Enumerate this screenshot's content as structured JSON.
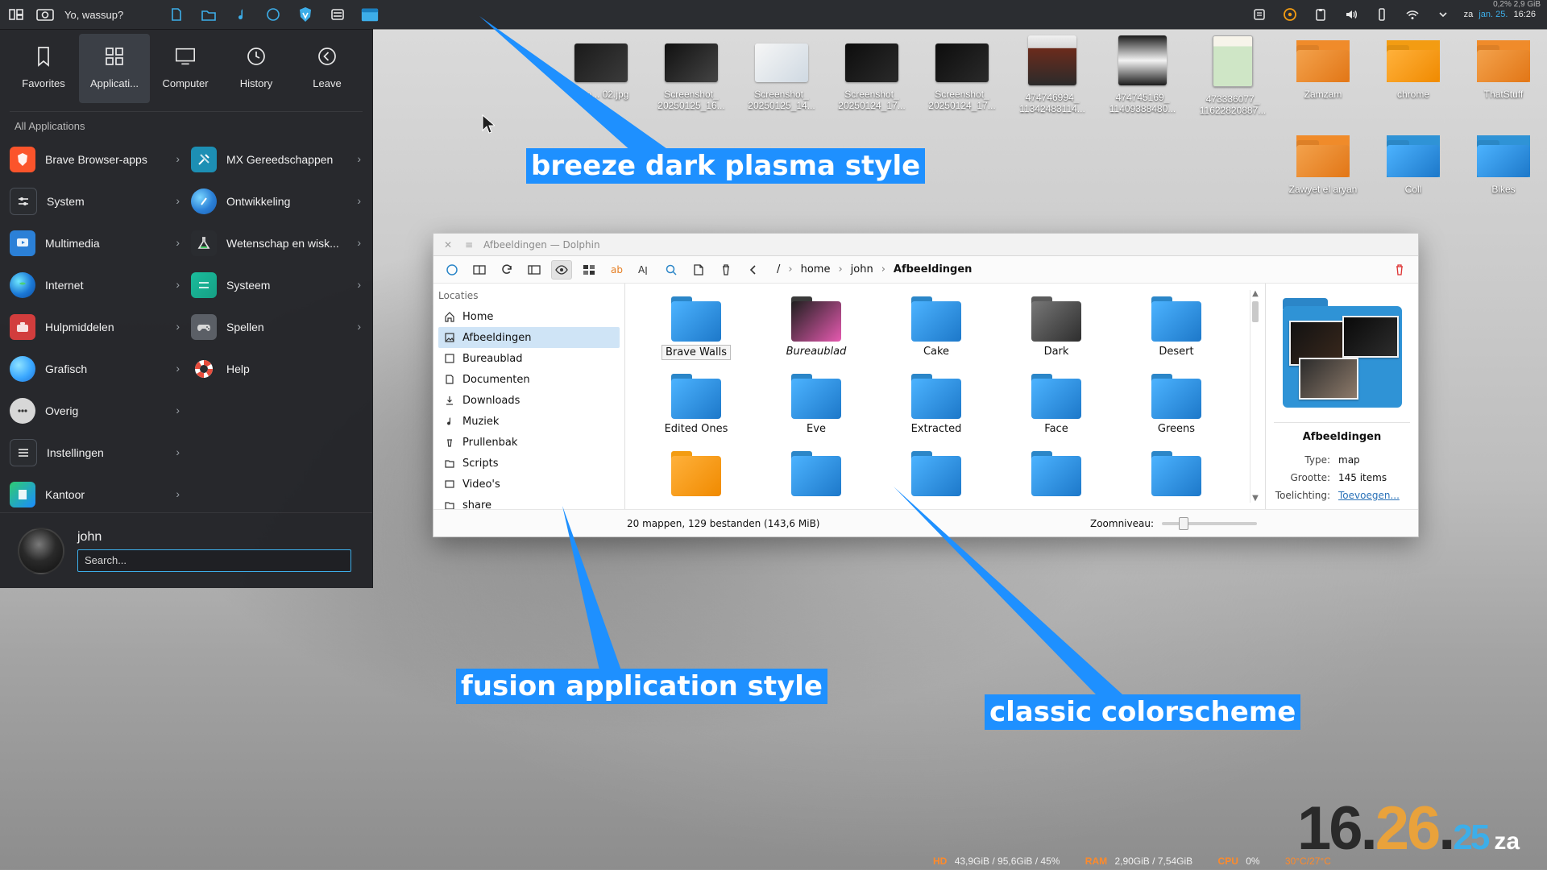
{
  "top_panel": {
    "title": "Yo, wassup?",
    "clock": {
      "prefix": "za",
      "date": "jan. 25.",
      "time": "16:26"
    },
    "sys_usage": "0,2% 2,9 GiB"
  },
  "launcher": {
    "tabs": [
      {
        "label": "Favorites",
        "icon": "bookmark-icon",
        "active": false
      },
      {
        "label": "Applicati...",
        "icon": "grid-icon",
        "active": true
      },
      {
        "label": "Computer",
        "icon": "monitor-icon",
        "active": false
      },
      {
        "label": "History",
        "icon": "clock-icon",
        "active": false
      },
      {
        "label": "Leave",
        "icon": "arrow-left-circle-icon",
        "active": false
      }
    ],
    "section_title": "All Applications",
    "items_left": [
      {
        "label": "Brave Browser-apps",
        "icon": "brave-icon"
      },
      {
        "label": "System",
        "icon": "system-icon"
      },
      {
        "label": "Multimedia",
        "icon": "multimedia-icon"
      },
      {
        "label": "Internet",
        "icon": "globe-icon"
      },
      {
        "label": "Hulpmiddelen",
        "icon": "toolbox-icon"
      },
      {
        "label": "Grafisch",
        "icon": "graphics-icon"
      },
      {
        "label": "Overig",
        "icon": "more-icon"
      },
      {
        "label": "Instellingen",
        "icon": "settings-icon"
      },
      {
        "label": "Kantoor",
        "icon": "office-icon"
      }
    ],
    "items_right": [
      {
        "label": "MX Gereedschappen",
        "icon": "tools-icon"
      },
      {
        "label": "Ontwikkeling",
        "icon": "development-icon"
      },
      {
        "label": "Wetenschap en wisk...",
        "icon": "science-icon"
      },
      {
        "label": "Systeem",
        "icon": "system-settings-icon"
      },
      {
        "label": "Spellen",
        "icon": "gamepad-icon"
      },
      {
        "label": "Help",
        "icon": "help-lifebuoy-icon"
      }
    ],
    "user": {
      "name": "john",
      "search_placeholder": "Search..."
    }
  },
  "desktop": {
    "icons_row1": [
      {
        "label": "scre... 02.jpg",
        "type": "thumb"
      },
      {
        "label": "Screenshot_ 20250125_16...",
        "type": "thumb"
      },
      {
        "label": "Screenshot_ 20250125_14...",
        "type": "thumb"
      },
      {
        "label": "Screenshot_ 20250124_17...",
        "type": "thumb"
      },
      {
        "label": "Screenshot_ 20250124_17...",
        "type": "thumb"
      },
      {
        "label": "474746994_ 11342483114...",
        "type": "thumb"
      },
      {
        "label": "474745169_ 11409388480...",
        "type": "thumb"
      },
      {
        "label": "473336077_ 11622820887...",
        "type": "thumb"
      },
      {
        "label": "Zamzam",
        "type": "folder"
      },
      {
        "label": "chrome",
        "type": "folder"
      },
      {
        "label": "ThatStuff",
        "type": "folder"
      }
    ],
    "icons_row2": [
      {
        "label": "Zawyet el aryan",
        "type": "folder"
      },
      {
        "label": "Coll",
        "type": "folder"
      },
      {
        "label": "Bikes",
        "type": "folder"
      }
    ]
  },
  "dolphin": {
    "window_title": "Afbeeldingen — Dolphin",
    "breadcrumb": [
      "/",
      "home",
      "john",
      "Afbeeldingen"
    ],
    "places_header": "Locaties",
    "places": [
      {
        "label": "Home",
        "icon": "home-icon",
        "active": false
      },
      {
        "label": "Afbeeldingen",
        "icon": "pictures-icon",
        "active": true
      },
      {
        "label": "Bureaublad",
        "icon": "desktop-icon",
        "active": false
      },
      {
        "label": "Documenten",
        "icon": "documents-icon",
        "active": false
      },
      {
        "label": "Downloads",
        "icon": "downloads-icon",
        "active": false
      },
      {
        "label": "Muziek",
        "icon": "music-icon",
        "active": false
      },
      {
        "label": "Prullenbak",
        "icon": "trash-icon",
        "active": false
      },
      {
        "label": "Scripts",
        "icon": "folder-icon",
        "active": false
      },
      {
        "label": "Video's",
        "icon": "video-icon",
        "active": false
      },
      {
        "label": "share",
        "icon": "folder-icon",
        "active": false
      }
    ],
    "folders": [
      {
        "label": "Brave Walls",
        "style": "boxed"
      },
      {
        "label": "Bureaublad",
        "style": "italic"
      },
      {
        "label": "Cake",
        "style": "normal"
      },
      {
        "label": "Dark",
        "style": "normal"
      },
      {
        "label": "Desert",
        "style": "normal"
      },
      {
        "label": "Edited Ones",
        "style": "normal"
      },
      {
        "label": "Eve",
        "style": "normal"
      },
      {
        "label": "Extracted",
        "style": "normal"
      },
      {
        "label": "Face",
        "style": "normal"
      },
      {
        "label": "Greens",
        "style": "normal"
      },
      {
        "label": "",
        "style": "normal"
      },
      {
        "label": "",
        "style": "normal"
      },
      {
        "label": "",
        "style": "normal"
      },
      {
        "label": "",
        "style": "normal"
      },
      {
        "label": "",
        "style": "normal"
      }
    ],
    "info_panel": {
      "name": "Afbeeldingen",
      "type_label": "Type:",
      "type_value": "map",
      "size_label": "Grootte:",
      "size_value": "145 items",
      "comment_label": "Toelichting:",
      "comment_link": "Toevoegen..."
    },
    "status": {
      "summary": "20 mappen, 129 bestanden (143,6 MiB)",
      "zoom_label": "Zoomniveau:",
      "zoom_level_fraction": 0.2
    }
  },
  "callouts": [
    {
      "text": "breeze dark plasma style"
    },
    {
      "text": "fusion application style"
    },
    {
      "text": "classic colorscheme"
    }
  ],
  "stats": {
    "hd_label": "HD",
    "hd_value": "43,9GiB / 95,6GiB / 45%",
    "ram_label": "RAM",
    "ram_value": "2,90GiB / 7,54GiB",
    "cpu_label": "CPU",
    "cpu_value": "0%",
    "temp_value": "30°C/27°C"
  },
  "big_clock": {
    "hh": "16",
    "mm": "26",
    "ss": "25",
    "suffix": "za"
  },
  "colors": {
    "accent": "#3daee9",
    "callout_blue": "#1e90ff",
    "clock_orange": "#e9a23b",
    "stats_orange": "#ff8a2a"
  }
}
